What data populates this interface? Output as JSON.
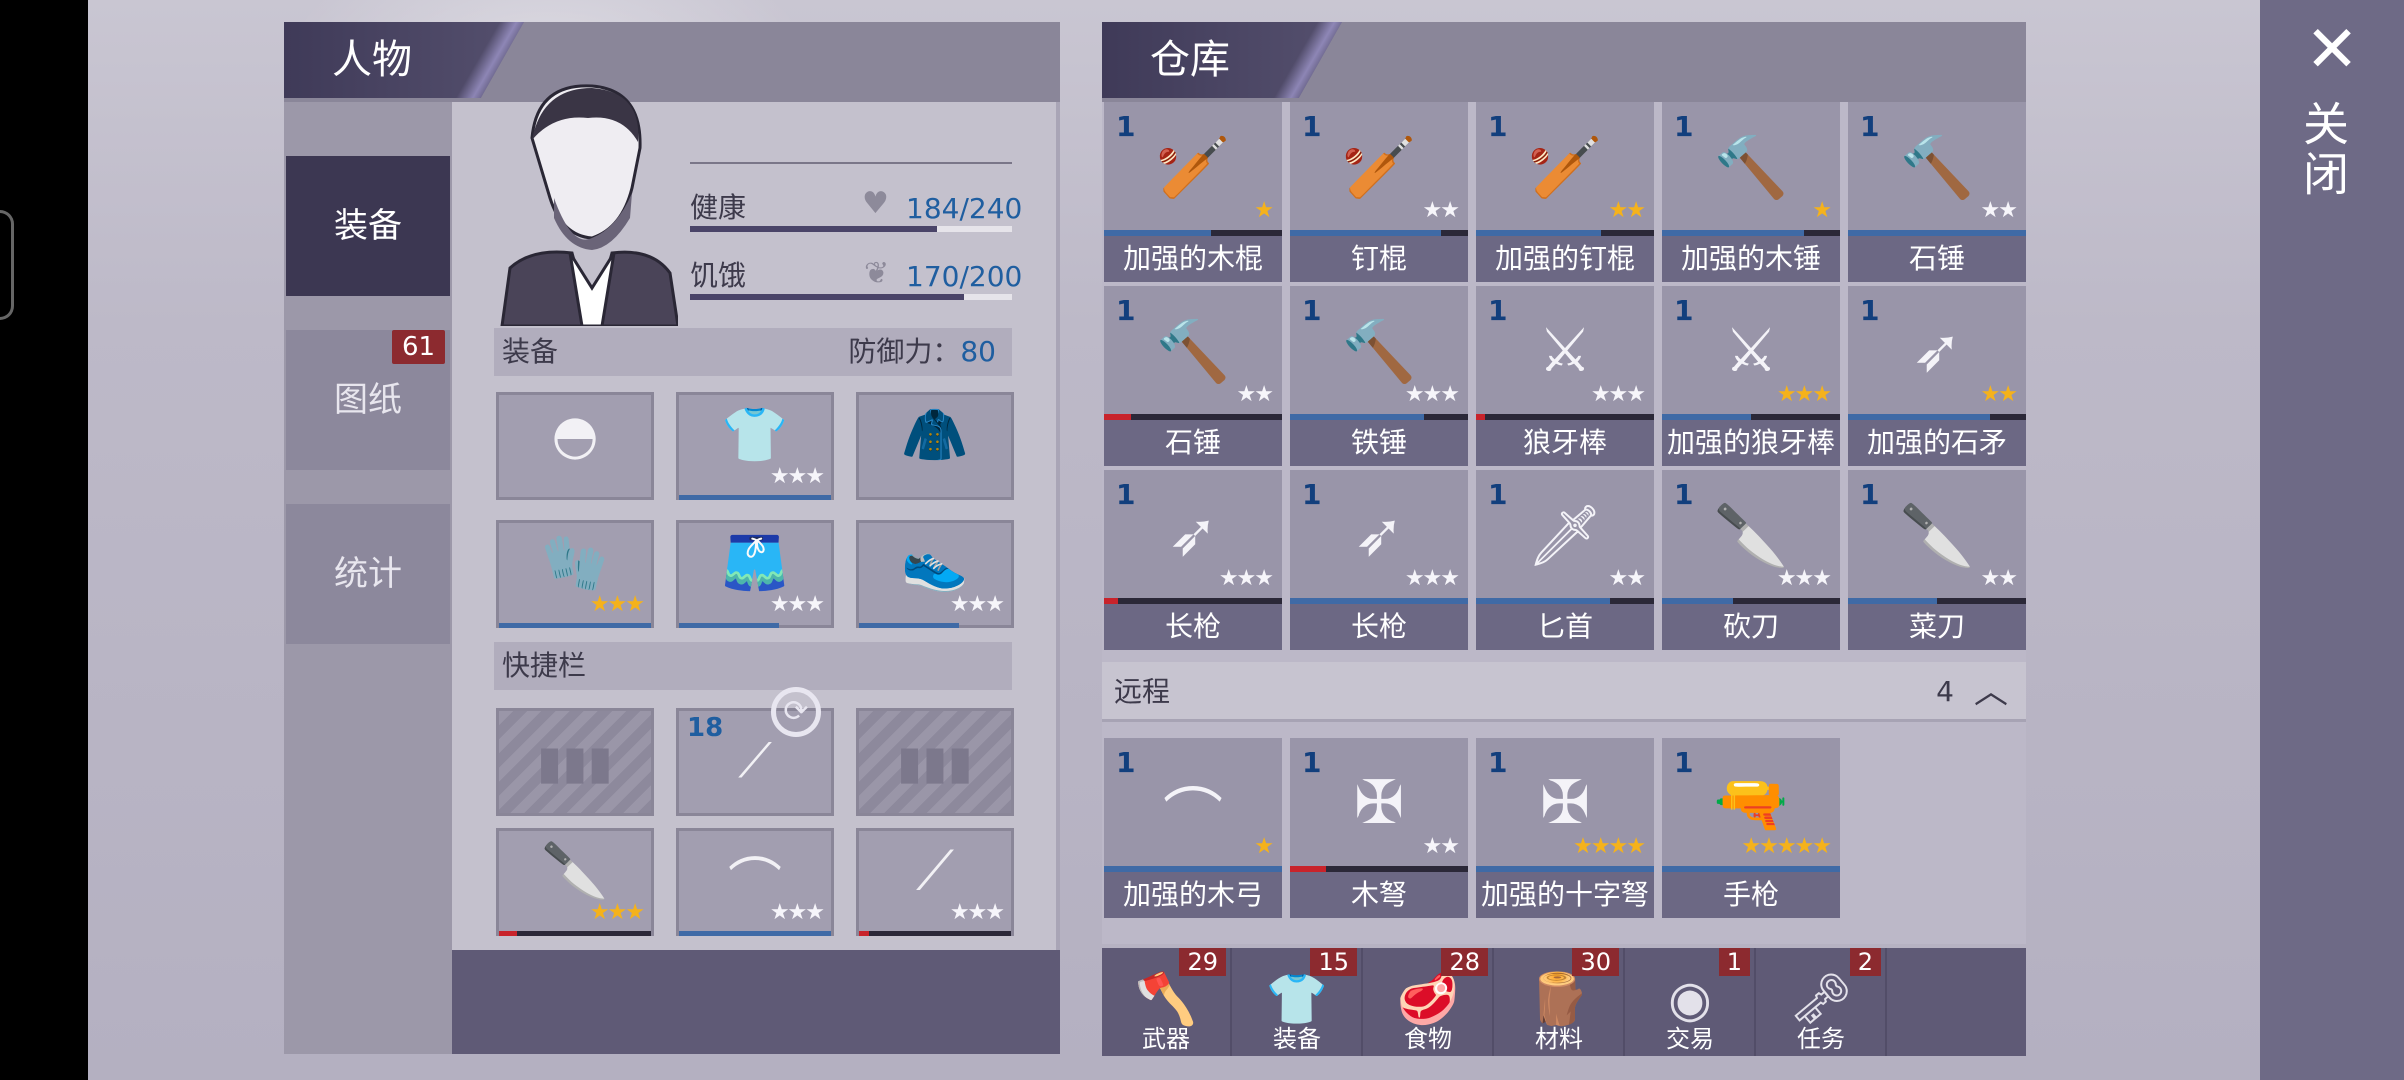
{
  "character": {
    "title": "人物",
    "tabs": [
      {
        "label": "装备"
      },
      {
        "label": "图纸",
        "badge": "61"
      },
      {
        "label": "统计"
      }
    ],
    "health": {
      "label": "健康",
      "value": "184/240",
      "fraction": 0.767
    },
    "hunger": {
      "label": "饥饿",
      "value": "170/200",
      "fraction": 0.85
    },
    "equipment_label": "装备",
    "defense_label": "防御力：",
    "defense_value": "80",
    "quickbar_label": "快捷栏",
    "quickbar_ammo": "18"
  },
  "warehouse": {
    "title": "仓库",
    "melee": [
      {
        "qty": "1",
        "name": "加强的木棍",
        "stars": 1,
        "gold": true,
        "durability": 0.6,
        "icon": "club"
      },
      {
        "qty": "1",
        "name": "钉棍",
        "stars": 2,
        "gold": false,
        "durability": 0.85,
        "icon": "spiked-club"
      },
      {
        "qty": "1",
        "name": "加强的钉棍",
        "stars": 2,
        "gold": true,
        "durability": 0.7,
        "icon": "spiked-club"
      },
      {
        "qty": "1",
        "name": "加强的木锤",
        "stars": 1,
        "gold": true,
        "durability": 0.8,
        "icon": "hammer"
      },
      {
        "qty": "1",
        "name": "石锤",
        "stars": 2,
        "gold": false,
        "durability": 1.0,
        "icon": "stone-hammer"
      },
      {
        "qty": "1",
        "name": "石锤",
        "stars": 2,
        "gold": false,
        "durability": 0.15,
        "icon": "stone-hammer"
      },
      {
        "qty": "1",
        "name": "铁锤",
        "stars": 3,
        "gold": false,
        "durability": 0.75,
        "icon": "iron-hammer"
      },
      {
        "qty": "1",
        "name": "狼牙棒",
        "stars": 3,
        "gold": false,
        "durability": 0.05,
        "icon": "mace"
      },
      {
        "qty": "1",
        "name": "加强的狼牙棒",
        "stars": 3,
        "gold": true,
        "durability": 0.5,
        "icon": "mace"
      },
      {
        "qty": "1",
        "name": "加强的石矛",
        "stars": 2,
        "gold": true,
        "durability": 0.8,
        "icon": "spear"
      },
      {
        "qty": "1",
        "name": "长枪",
        "stars": 3,
        "gold": false,
        "durability": 0.08,
        "icon": "long-spear"
      },
      {
        "qty": "1",
        "name": "长枪",
        "stars": 3,
        "gold": false,
        "durability": 1.0,
        "icon": "long-spear"
      },
      {
        "qty": "1",
        "name": "匕首",
        "stars": 2,
        "gold": false,
        "durability": 0.75,
        "icon": "dagger"
      },
      {
        "qty": "1",
        "name": "砍刀",
        "stars": 3,
        "gold": false,
        "durability": 0.4,
        "icon": "machete"
      },
      {
        "qty": "1",
        "name": "菜刀",
        "stars": 2,
        "gold": false,
        "durability": 0.5,
        "icon": "cleaver"
      }
    ],
    "ranged_label": "远程",
    "ranged_count": "4",
    "ranged": [
      {
        "qty": "1",
        "name": "加强的木弓",
        "stars": 1,
        "gold": true,
        "durability": 1.0,
        "icon": "bow"
      },
      {
        "qty": "1",
        "name": "木弩",
        "stars": 2,
        "gold": false,
        "durability": 0.2,
        "icon": "crossbow"
      },
      {
        "qty": "1",
        "name": "加强的十字弩",
        "stars": 4,
        "gold": true,
        "durability": 1.0,
        "icon": "crossbow"
      },
      {
        "qty": "1",
        "name": "手枪",
        "stars": 5,
        "gold": true,
        "durability": 1.0,
        "icon": "pistol"
      }
    ],
    "categories": [
      {
        "label": "武器",
        "badge": "29",
        "icon": "axe-icon"
      },
      {
        "label": "装备",
        "badge": "15",
        "icon": "shirt-icon"
      },
      {
        "label": "食物",
        "badge": "28",
        "icon": "meat-icon"
      },
      {
        "label": "材料",
        "badge": "30",
        "icon": "log-icon"
      },
      {
        "label": "交易",
        "badge": "1",
        "icon": "coin-icon"
      },
      {
        "label": "任务",
        "badge": "2",
        "icon": "key-icon"
      }
    ]
  },
  "close_label": "关闭"
}
